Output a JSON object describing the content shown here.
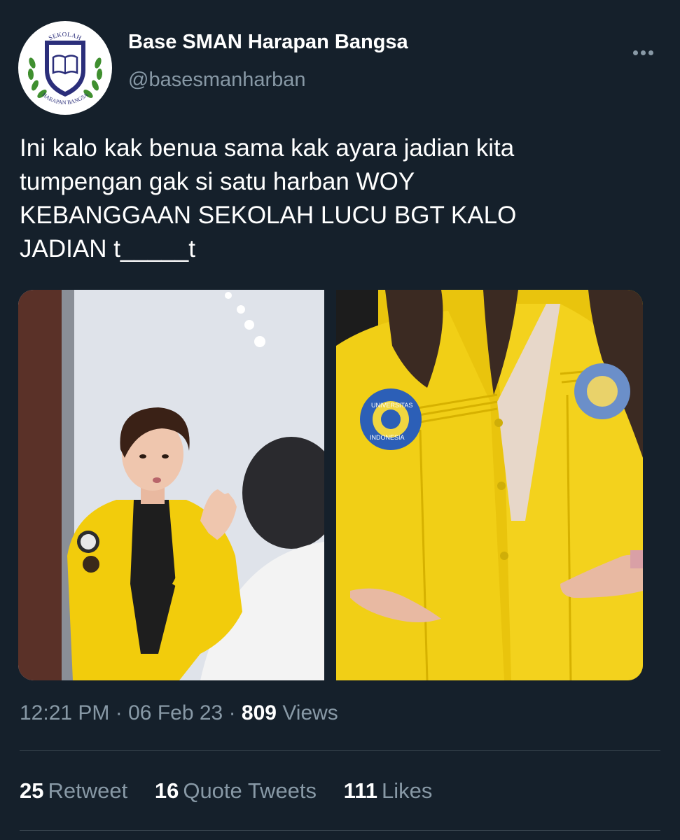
{
  "tweet": {
    "display_name": "Base SMAN Harapan Bangsa",
    "handle": "@basesmanharban",
    "avatar_icon": "school-crest-icon",
    "avatar_text_top": "SEKOLAH",
    "avatar_text_bottom": "HARAPAN BANGSA",
    "text_lines": [
      "Ini kalo kak benua sama kak ayara jadian kita",
      "tumpengan gak si satu harban WOY",
      "KEBANGGAAN SEKOLAH LUCU BGT KALO",
      "JADIAN t_____t"
    ],
    "time": "12:21 PM",
    "separator": "·",
    "date": "06 Feb 23",
    "views_count": "809",
    "views_label": "Views"
  },
  "stats": {
    "retweets": "25",
    "retweets_label": "Retweet",
    "quotes": "16",
    "quotes_label": "Quote Tweets",
    "likes": "111",
    "likes_label": "Likes"
  },
  "media": {
    "right_badge_text_top": "UNIVERSITAS",
    "right_badge_text_bottom": "INDONESIA"
  },
  "colors": {
    "background": "#15202b",
    "secondary_text": "#8899a6",
    "divider": "#38444d",
    "jacket_yellow": "#f2cc0c"
  }
}
